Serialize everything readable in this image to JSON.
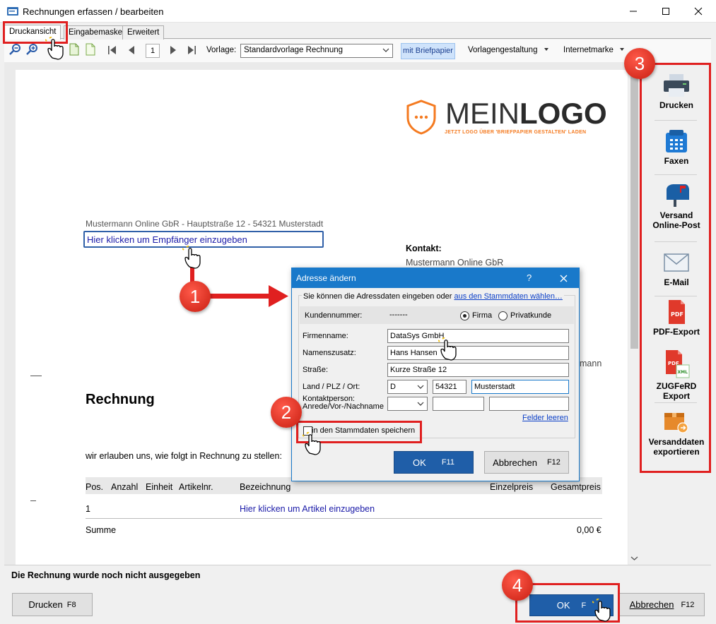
{
  "window": {
    "title": "Rechnungen erfassen / bearbeiten"
  },
  "tabs": [
    {
      "label": "Druckansicht",
      "active": true
    },
    {
      "label": "Eingabemaske",
      "active": false
    },
    {
      "label": "Erweitert",
      "active": false
    }
  ],
  "toolbar": {
    "page_number": "1",
    "vorlage_label": "Vorlage:",
    "vorlage_value": "Standardvorlage Rechnung",
    "briefpapier_label": "mit Briefpapier",
    "vorlagengestaltung_label": "Vorlagengestaltung",
    "internetmarke_label": "Internetmarke"
  },
  "document": {
    "logo_text_light": "MEIN",
    "logo_text_bold": "LOGO",
    "logo_tagline": "JETZT LOGO ÜBER 'BRIEFPAPIER GESTALTEN' LADEN",
    "sender_line": "Mustermann Online GbR - Hauptstraße 12 - 54321 Musterstadt",
    "recipient_placeholder": "Hier klicken um Empfänger einzugeben",
    "kontakt_label": "Kontakt:",
    "kontakt_name": "Mustermann Online GbR",
    "partial_text": "mann",
    "heading": "Rechnung",
    "intro": "wir erlauben uns, wie folgt in Rechnung zu stellen:",
    "columns": {
      "pos": "Pos.",
      "anzahl": "Anzahl",
      "einheit": "Einheit",
      "artikelnr": "Artikelnr.",
      "bezeichnung": "Bezeichnung",
      "einzelpreis": "Einzelpreis",
      "gesamtpreis": "Gesamtpreis"
    },
    "row1_pos": "1",
    "row1_article_placeholder": "Hier klicken um Artikel einzugeben",
    "summe_label": "Summe",
    "summe_value": "0,00 €"
  },
  "sidebar": {
    "items": [
      {
        "label": "Drucken"
      },
      {
        "label": "Faxen"
      },
      {
        "label": "Versand Online-Post"
      },
      {
        "label": "E-Mail"
      },
      {
        "label": "PDF-Export"
      },
      {
        "label": "ZUGFeRD Export"
      },
      {
        "label": "Versanddaten exportieren"
      }
    ]
  },
  "dialog": {
    "title": "Adresse ändern",
    "help": "?",
    "hint": "Sie können die Adressdaten eingeben oder",
    "hint_link": "aus den Stammdaten wählen…",
    "kundennummer_label": "Kundennummer:",
    "kundennummer_value": "-------",
    "radio_firma": "Firma",
    "radio_privat": "Privatkunde",
    "firmenname_label": "Firmenname:",
    "firmenname_value": "DataSys GmbH",
    "namenszusatz_label": "Namenszusatz:",
    "namenszusatz_value": "Hans Hansen",
    "strasse_label": "Straße:",
    "strasse_value": "Kurze Straße 12",
    "land_label": "Land / PLZ / Ort:",
    "land_value": "D",
    "plz_value": "54321",
    "ort_value": "Musterstadt",
    "kontakt_label_1": "Kontaktperson:",
    "kontakt_label_2": "Anrede/Vor-/Nachname",
    "felder_leeren": "Felder leeren",
    "save_checkbox_label": "in den Stammdaten speichern",
    "ok_label": "OK",
    "ok_key": "F11",
    "cancel_label": "Abbrechen",
    "cancel_key": "F12"
  },
  "status": {
    "text": "Die Rechnung wurde noch nicht ausgegeben"
  },
  "bottom": {
    "print_label": "Drucken",
    "print_key": "F8",
    "ok_label": "OK",
    "ok_key": "F",
    "cancel_label": "Abbrechen",
    "cancel_key": "F12"
  },
  "annotations": {
    "badges": [
      "1",
      "2",
      "3",
      "4"
    ]
  },
  "colors": {
    "accent_blue": "#1979ca",
    "button_blue": "#1f5ea8",
    "logo_orange": "#f47a20",
    "annotation_red": "#e02020"
  }
}
